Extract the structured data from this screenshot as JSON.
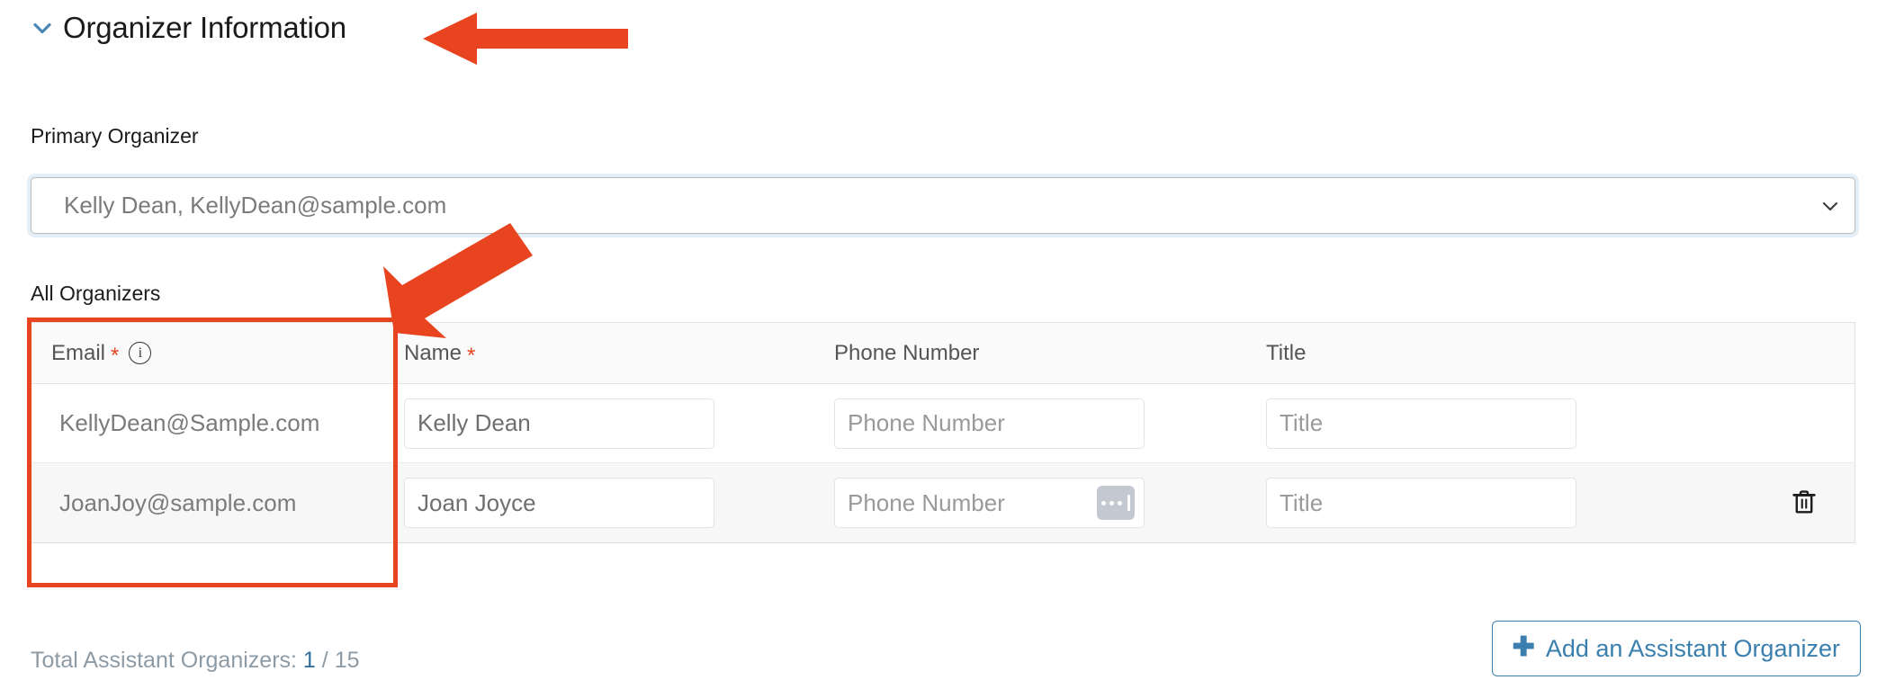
{
  "section": {
    "title": "Organizer Information",
    "collapse_icon": "chevron-down-icon",
    "expanded": true
  },
  "primary_organizer": {
    "label": "Primary Organizer",
    "selected_value": "Kelly Dean, KellyDean@sample.com",
    "caret_icon": "chevron-down-icon"
  },
  "all_organizers": {
    "label": "All Organizers",
    "columns": [
      {
        "label": "Email",
        "required": true,
        "has_info_icon": true,
        "info_icon": "info-circle-icon"
      },
      {
        "label": "Name",
        "required": true,
        "has_info_icon": false
      },
      {
        "label": "Phone Number",
        "required": false,
        "has_info_icon": false
      },
      {
        "label": "Title",
        "required": false,
        "has_info_icon": false
      }
    ],
    "required_marker": "*",
    "info_glyph": "i",
    "rows": [
      {
        "email": "KellyDean@Sample.com",
        "name_value": "Kelly Dean",
        "name_placeholder": "Name",
        "phone_value": "",
        "phone_placeholder": "Phone Number",
        "title_value": "",
        "title_placeholder": "Title",
        "has_autofill_badge": false,
        "has_delete": false,
        "delete_icon": "trash-icon"
      },
      {
        "email": "JoanJoy@sample.com",
        "name_value": "Joan Joyce",
        "name_placeholder": "Name",
        "phone_value": "",
        "phone_placeholder": "Phone Number",
        "title_value": "",
        "title_placeholder": "Title",
        "has_autofill_badge": true,
        "autofill_icon": "autofill-dots-icon",
        "has_delete": true,
        "delete_icon": "trash-icon"
      }
    ]
  },
  "footer": {
    "total_prefix": "Total Assistant Organizers:",
    "total_current": "1",
    "total_separator": "/",
    "total_max": "15",
    "add_button_label": "Add an Assistant Organizer",
    "add_button_icon": "plus-icon"
  },
  "colors": {
    "accent_blue": "#3b7fae",
    "annotation_red": "#e8441f",
    "required_red": "#e8441f",
    "text_dark": "#1b1b1b",
    "text_muted": "#7b7b7b",
    "count_blue": "#2f6f9f"
  },
  "annotations": [
    {
      "type": "arrow",
      "points_to": "section-title",
      "color": "#e8441f"
    },
    {
      "type": "arrow",
      "points_to": "email-column-header",
      "color": "#e8441f"
    },
    {
      "type": "box",
      "surrounds": "email-column",
      "color": "#e8441f"
    }
  ]
}
